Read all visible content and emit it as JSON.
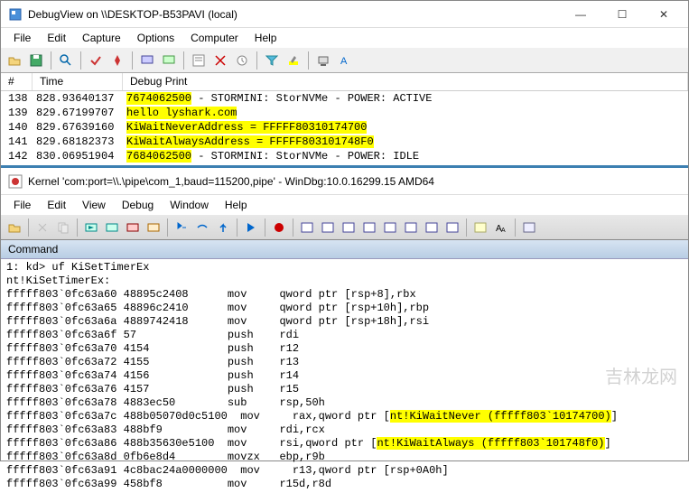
{
  "win1": {
    "title": "DebugView on \\\\DESKTOP-B53PAVI (local)",
    "menu": [
      "File",
      "Edit",
      "Capture",
      "Options",
      "Computer",
      "Help"
    ],
    "headers": {
      "num": "#",
      "time": "Time",
      "print": "Debug Print"
    },
    "rows": [
      {
        "n": "138",
        "t": "828.93640137",
        "p": "7674062500 - STORMINI: StorNVMe - POWER: ACTIVE",
        "hl": false,
        "pre_hl": true
      },
      {
        "n": "139",
        "t": "829.67199707",
        "p": "hello lyshark.com",
        "hl": true
      },
      {
        "n": "140",
        "t": "829.67639160",
        "p": "KiWaitNeverAddress = FFFFF80310174700",
        "hl": true
      },
      {
        "n": "141",
        "t": "829.68182373",
        "p": "KiWaitAlwaysAddress = FFFFF803101748F0",
        "hl": true
      },
      {
        "n": "142",
        "t": "830.06951904",
        "p": "7684062500 - STORMINI: StorNVMe - POWER: IDLE",
        "hl": false,
        "pre_hl": true
      }
    ]
  },
  "win2": {
    "title": "Kernel 'com:port=\\\\.\\pipe\\com_1,baud=115200,pipe' - WinDbg:10.0.16299.15 AMD64",
    "menu": [
      "File",
      "Edit",
      "View",
      "Debug",
      "Window",
      "Help"
    ],
    "cmd_title": "Command",
    "prompt": "1: kd> uf KiSetTimerEx",
    "sym": "nt!KiSetTimerEx:",
    "lines": [
      {
        "a": "fffff803`0fc63a60 48895c2408      mov     qword ptr [rsp+8],rbx"
      },
      {
        "a": "fffff803`0fc63a65 48896c2410      mov     qword ptr [rsp+10h],rbp"
      },
      {
        "a": "fffff803`0fc63a6a 4889742418      mov     qword ptr [rsp+18h],rsi"
      },
      {
        "a": "fffff803`0fc63a6f 57              push    rdi"
      },
      {
        "a": "fffff803`0fc63a70 4154            push    r12"
      },
      {
        "a": "fffff803`0fc63a72 4155            push    r13"
      },
      {
        "a": "fffff803`0fc63a74 4156            push    r14"
      },
      {
        "a": "fffff803`0fc63a76 4157            push    r15"
      },
      {
        "a": "fffff803`0fc63a78 4883ec50        sub     rsp,50h"
      },
      {
        "a": "fffff803`0fc63a7c 488b05070d0c5100  mov     rax,qword ptr [",
        "h": "nt!KiWaitNever (fffff803`10174700)",
        "t": "]"
      },
      {
        "a": "fffff803`0fc63a83 488bf9          mov     rdi,rcx"
      },
      {
        "a": "fffff803`0fc63a86 488b35630e5100  mov     rsi,qword ptr [",
        "h": "nt!KiWaitAlways (fffff803`101748f0)",
        "t": "]"
      },
      {
        "a": "fffff803`0fc63a8d 0fb6e8d4        movzx   ebp,r9b"
      },
      {
        "a": "fffff803`0fc63a91 4c8bac24a0000000  mov     r13,qword ptr [rsp+0A0h]"
      },
      {
        "a": "fffff803`0fc63a99 458bf8          mov     r15d,r8d"
      }
    ]
  },
  "watermark": "吉林龙网"
}
